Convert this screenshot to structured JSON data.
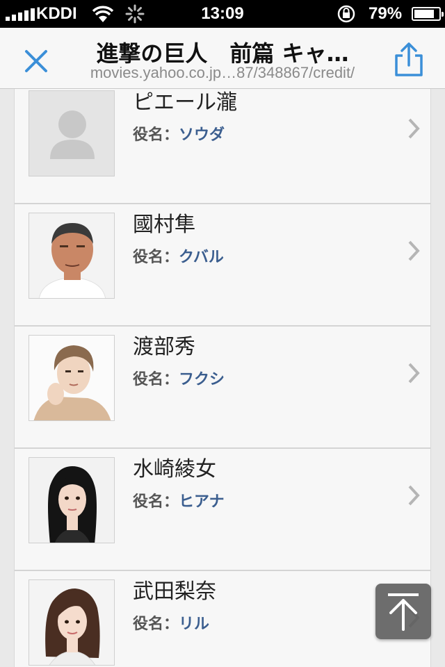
{
  "status": {
    "carrier": "KDDI",
    "time": "13:09",
    "battery": "79%",
    "battery_level": 0.79
  },
  "header": {
    "title": "進撃の巨人　前篇 キャ…",
    "url": "movies.yahoo.co.jp…87/348867/credit/"
  },
  "cast": [
    {
      "name": "ピエール瀧",
      "role_label": "役名：",
      "role": "ソウダ",
      "photo": "placeholder"
    },
    {
      "name": "國村隼",
      "role_label": "役名：",
      "role": "クバル",
      "photo": "older-man"
    },
    {
      "name": "渡部秀",
      "role_label": "役名：",
      "role": "フクシ",
      "photo": "young-man"
    },
    {
      "name": "水崎綾女",
      "role_label": "役名：",
      "role": "ヒアナ",
      "photo": "woman-dark-hair"
    },
    {
      "name": "武田梨奈",
      "role_label": "役名：",
      "role": "リル",
      "photo": "woman-brown-hair"
    }
  ],
  "colors": {
    "accent": "#3b8fd8",
    "role_value": "#3b5e8f"
  },
  "icons": {
    "close": "close-icon",
    "share": "share-icon",
    "chevron": "chevron-right-icon",
    "scroll_top": "arrow-up-icon"
  }
}
